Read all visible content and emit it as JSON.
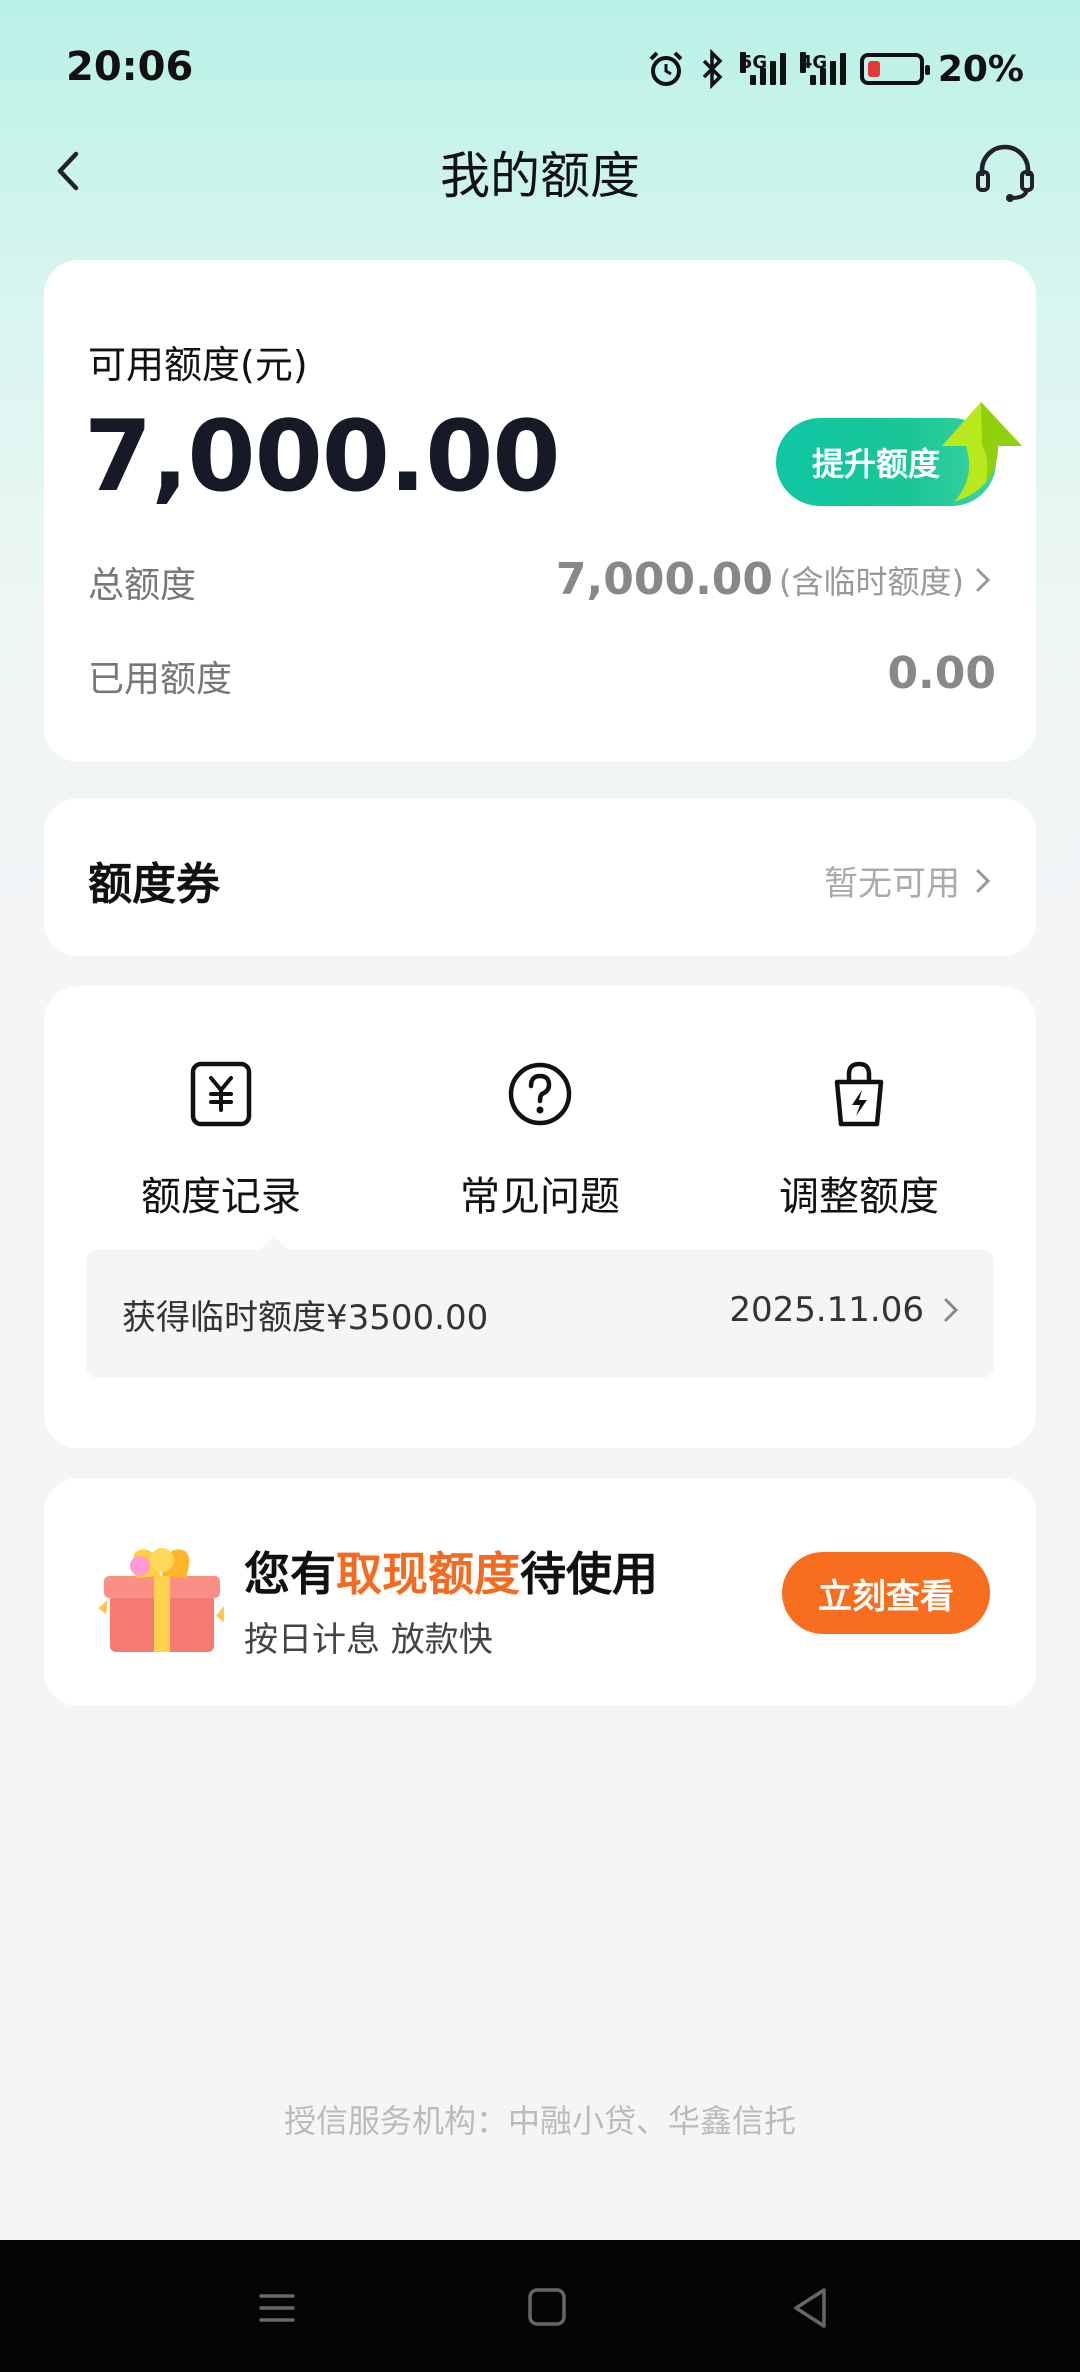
{
  "status_bar": {
    "time": "20:06",
    "network1": "5G",
    "network2": "4G",
    "battery": "20%"
  },
  "header": {
    "title": "我的额度"
  },
  "quota_card": {
    "available_label": "可用额度(元)",
    "available_amount": "7,000.00",
    "raise_button": "提升额度",
    "total_label": "总额度",
    "total_value": "7,000.00",
    "total_note": "(含临时额度)",
    "used_label": "已用额度",
    "used_value": "0.00"
  },
  "coupon_card": {
    "title": "额度券",
    "status": "暂无可用"
  },
  "actions": {
    "items": [
      {
        "label": "额度记录",
        "icon": "yen-receipt-icon"
      },
      {
        "label": "常见问题",
        "icon": "question-circle-icon"
      },
      {
        "label": "调整额度",
        "icon": "lightning-bag-icon"
      }
    ],
    "record": {
      "text": "获得临时额度¥3500.00",
      "date": "2025.11.06"
    }
  },
  "promo": {
    "title_prefix": "您有",
    "title_highlight": "取现额度",
    "title_suffix": "待使用",
    "subtitle": "按日计息 放款快",
    "button": "立刻查看",
    "highlight_color": "#f46a1e"
  },
  "footer": {
    "note": "授信服务机构：中融小贷、华鑫信托"
  },
  "colors": {
    "accent": "#19c696",
    "promo_button": "#f86e1e"
  }
}
